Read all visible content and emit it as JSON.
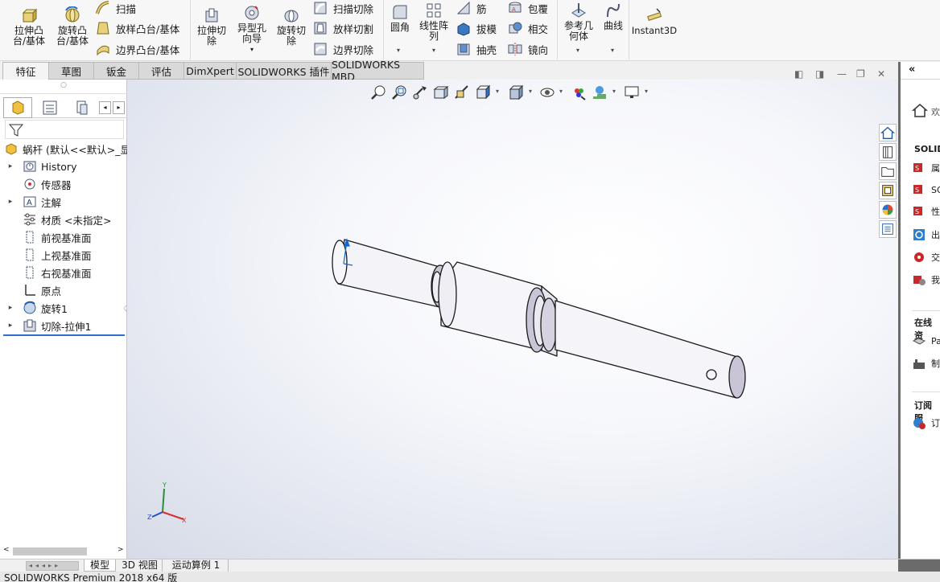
{
  "ribbon": {
    "extrude_boss": "拉伸凸台/基体",
    "revolve_boss": "旋转凸台/基体",
    "sweep": "扫描",
    "loft_boss": "放样凸台/基体",
    "boundary_boss": "边界凸台/基体",
    "extrude_cut": "拉伸切除",
    "hole_wizard": "异型孔向导",
    "revolve_cut": "旋转切除",
    "sweep_cut": "扫描切除",
    "loft_cut": "放样切割",
    "boundary_cut": "边界切除",
    "fillet": "圆角",
    "linear_pattern": "线性阵列",
    "rib": "筋",
    "draft": "拔模",
    "shell": "抽壳",
    "wrap": "包覆",
    "intersect": "相交",
    "mirror": "镜向",
    "ref_geometry": "参考几何体",
    "curves": "曲线",
    "instant3d": "Instant3D"
  },
  "tabs": [
    "特征",
    "草图",
    "钣金",
    "评估",
    "DimXpert",
    "SOLIDWORKS 插件",
    "SOLIDWORKS MBD"
  ],
  "tree": {
    "root": "蜗杆 (默认<<默认>_显",
    "items": [
      {
        "label": "History",
        "icon": "history-folder-icon",
        "expandable": true
      },
      {
        "label": "传感器",
        "icon": "sensor-icon",
        "expandable": false
      },
      {
        "label": "注解",
        "icon": "annotation-icon",
        "expandable": true
      },
      {
        "label": "材质 <未指定>",
        "icon": "material-icon",
        "expandable": false
      },
      {
        "label": "前视基准面",
        "icon": "plane-icon",
        "expandable": false
      },
      {
        "label": "上视基准面",
        "icon": "plane-icon",
        "expandable": false
      },
      {
        "label": "右视基准面",
        "icon": "plane-icon",
        "expandable": false
      },
      {
        "label": "原点",
        "icon": "origin-icon",
        "expandable": false
      },
      {
        "label": "旋转1",
        "icon": "revolve-feature-icon",
        "expandable": true
      },
      {
        "label": "切除-拉伸1",
        "icon": "cut-extrude-feature-icon",
        "expandable": true
      }
    ]
  },
  "bottom_tabs": [
    "模型",
    "3D 视图",
    "运动算例 1"
  ],
  "status_text": "SOLIDWORKS Premium 2018 x64 版",
  "taskpane": {
    "welcome": "欢",
    "solid_head": "SOLID",
    "online_head": "在线资",
    "subscribe_head": "订阅服",
    "rows": [
      "属",
      "SO",
      "性",
      "出",
      "交",
      "我",
      "Pa",
      "制",
      "订"
    ]
  },
  "colors": {
    "part_fill": "#f4f3f7",
    "part_shadow": "#c9c5d6",
    "part_edge": "#1a1a1a",
    "accent_blue": "#0a6ad1"
  }
}
